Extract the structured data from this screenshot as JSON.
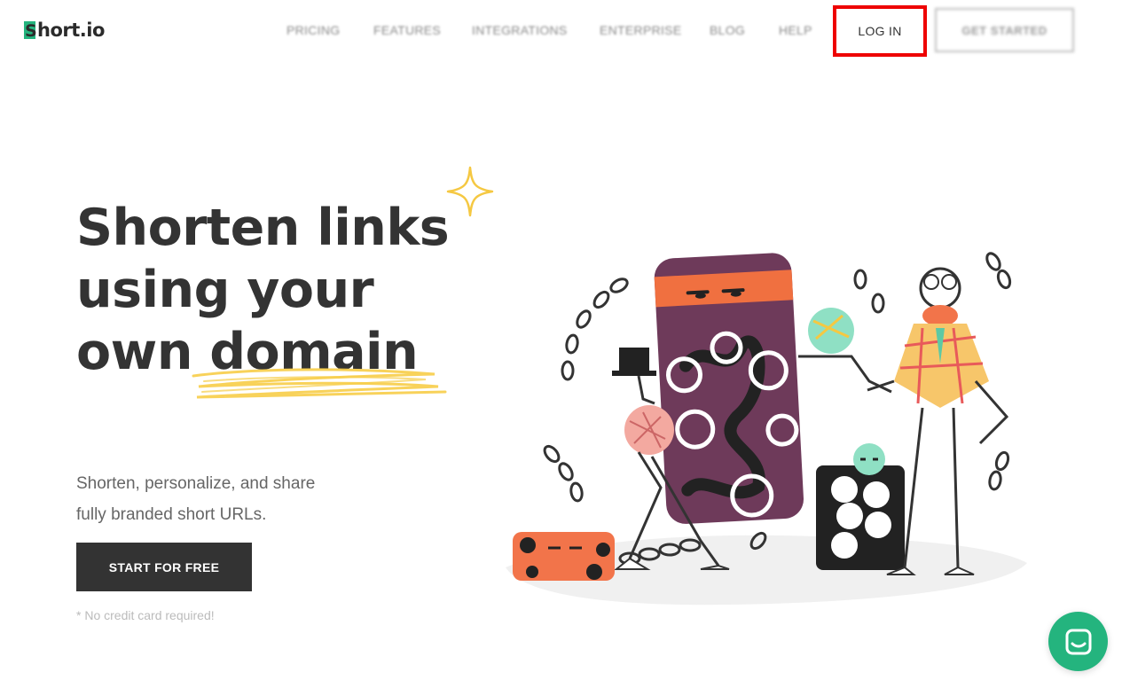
{
  "brand": {
    "logo_text": "hort.io",
    "logo_initial": "S",
    "accent_color": "#24b47e"
  },
  "nav": {
    "items": [
      "PRICING",
      "FEATURES",
      "INTEGRATIONS",
      "ENTERPRISE",
      "BLOG",
      "HELP"
    ],
    "login_label": "LOG IN",
    "get_started_label": "GET STARTED"
  },
  "hero": {
    "headline_line1": "Shorten links",
    "headline_line2": "using your",
    "headline_line3": "own domain",
    "subtext_line1": "Shorten, personalize, and share",
    "subtext_line2": "fully branded short URLs.",
    "cta_label": "START FOR FREE",
    "note": "* No credit card required!"
  },
  "chat": {
    "icon": "chat-icon"
  }
}
